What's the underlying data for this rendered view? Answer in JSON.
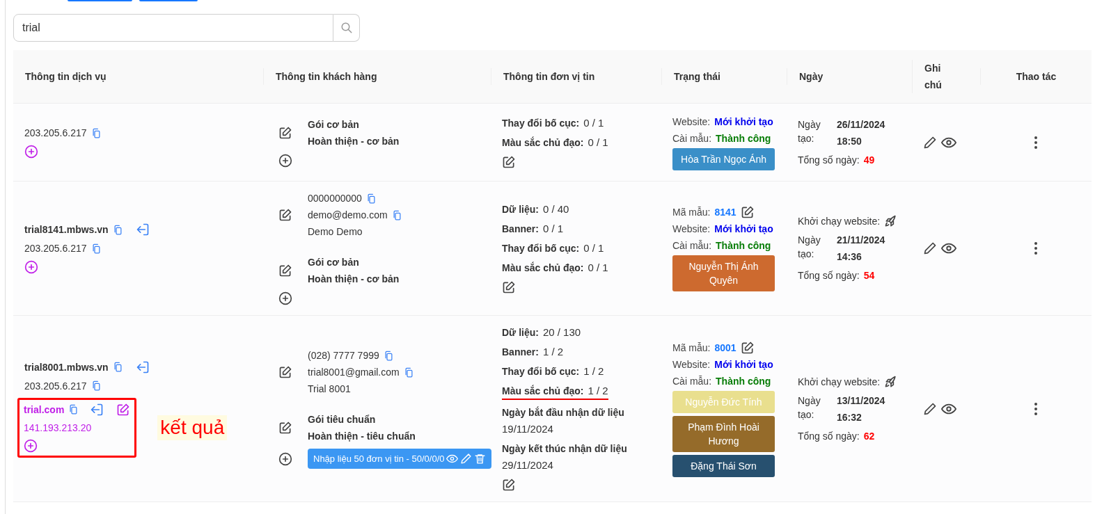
{
  "search": {
    "value": "trial"
  },
  "columns": [
    "Thông tin dịch vụ",
    "Thông tin khách hàng",
    "Thông tin đơn vị tin",
    "Trạng thái",
    "Ngày",
    "Ghi chú",
    "Thao tác"
  ],
  "rows": [
    {
      "service": {
        "ip": "203.205.6.217"
      },
      "customer": {
        "package": "Gói cơ bản",
        "completion": "Hoàn thiện - cơ bản"
      },
      "units": [
        {
          "label": "Thay đổi bố cục:",
          "value": "0 / 1",
          "underlined": false
        },
        {
          "label": "Màu sắc chủ đạo:",
          "value": "0 / 1",
          "underlined": false
        }
      ],
      "status": {
        "website_label": "Website:",
        "website": "Mới khởi tạo",
        "install_label": "Cài mẫu:",
        "install": "Thành công",
        "staff": [
          {
            "name": "Hòa Trần Ngọc Ánh",
            "color": "#3a8fc8"
          }
        ]
      },
      "date": {
        "created_label": "Ngày tạo:",
        "created_date": "26/11/2024",
        "created_time": "18:50",
        "days_label": "Tổng số ngày:",
        "days": "49"
      }
    },
    {
      "service": {
        "domain": "trial8141.mbws.vn",
        "ip": "203.205.6.217"
      },
      "customer": {
        "phone": "0000000000",
        "email": "demo@demo.com",
        "name": "Demo Demo",
        "package": "Gói cơ bản",
        "completion": "Hoàn thiện - cơ bản"
      },
      "units": [
        {
          "label": "Dữ liệu:",
          "value": "0 / 40",
          "underlined": false
        },
        {
          "label": "Banner:",
          "value": "0 / 1",
          "underlined": false
        },
        {
          "label": "Thay đổi bố cục:",
          "value": "0 / 1",
          "underlined": false
        },
        {
          "label": "Màu sắc chủ đạo:",
          "value": "0 / 1",
          "underlined": false
        }
      ],
      "status": {
        "code_label": "Mã mẫu:",
        "code": "8141",
        "website_label": "Website:",
        "website": "Mới khởi tạo",
        "install_label": "Cài mẫu:",
        "install": "Thành công",
        "staff": [
          {
            "name": "Nguyễn Thị Ánh Quyên",
            "color": "#cd6a2f"
          }
        ]
      },
      "date": {
        "launch": "Khởi chạy website:",
        "created_label": "Ngày tạo:",
        "created_date": "21/11/2024",
        "created_time": "14:36",
        "days_label": "Tổng số ngày:",
        "days": "54"
      }
    },
    {
      "service": {
        "domain": "trial8001.mbws.vn",
        "ip": "203.205.6.217",
        "extra": {
          "domain": "trial.com",
          "ip": "141.193.213.20"
        },
        "annotation": "kết quả"
      },
      "customer": {
        "phone": "(028) 7777 7999",
        "email": "trial8001@gmail.com",
        "name": "Trial 8001",
        "package": "Gói tiêu chuẩn",
        "completion": "Hoàn thiện - tiêu chuẩn",
        "task": "Nhập liệu 50 đơn vị tin - 50/0/0/0"
      },
      "units": [
        {
          "label": "Dữ liệu:",
          "value": "20 / 130",
          "underlined": false
        },
        {
          "label": "Banner:",
          "value": "1 / 2",
          "underlined": false
        },
        {
          "label": "Thay đổi bố cục:",
          "value": "1 / 2",
          "underlined": false
        },
        {
          "label": "Màu sắc chủ đạo:",
          "value": "1 / 2",
          "underlined": true
        }
      ],
      "periods": [
        {
          "label": "Ngày bắt đầu nhận dữ liệu",
          "value": "19/11/2024"
        },
        {
          "label": "Ngày kết thúc nhận dữ liệu",
          "value": "29/11/2024"
        }
      ],
      "status": {
        "code_label": "Mã mẫu:",
        "code": "8001",
        "website_label": "Website:",
        "website": "Mới khởi tạo",
        "install_label": "Cài mẫu:",
        "install": "Thành công",
        "staff": [
          {
            "name": "Nguyễn Đức Tính",
            "color": "#e9df8e"
          },
          {
            "name": "Phạm Đình Hoài Hương",
            "color": "#956b2a"
          },
          {
            "name": "Đặng Thái Sơn",
            "color": "#27506f"
          }
        ]
      },
      "date": {
        "launch": "Khởi chạy website:",
        "created_label": "Ngày tạo:",
        "created_date": "13/11/2024",
        "created_time": "16:32",
        "days_label": "Tổng số ngày:",
        "days": "62"
      }
    }
  ]
}
